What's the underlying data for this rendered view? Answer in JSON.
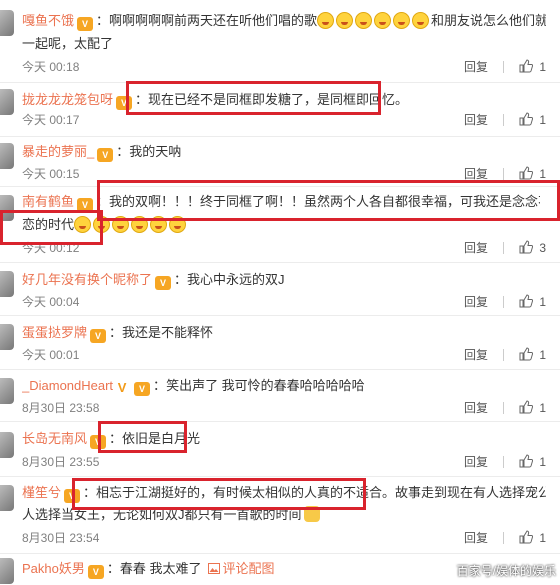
{
  "comments": [
    {
      "user": "嘎鱼不饿",
      "text": "啊啊啊啊啊前两天还在听他们唱的歌",
      "text_after": "和朋友说怎么他们就不在",
      "text_line2": "一起呢，太配了",
      "time": "今天 00:18",
      "reply": "回复",
      "likes": "1"
    },
    {
      "user": "拢龙龙龙笼包呀",
      "text": "现在已经不是同框即发糖了，是同框即回忆。",
      "time": "今天 00:17",
      "reply": "回复",
      "likes": "1"
    },
    {
      "user": "暴走的萝丽_",
      "text": "我的天呐",
      "time": "今天 00:15",
      "reply": "回复",
      "likes": "1"
    },
    {
      "user": "南有鹤鱼",
      "text": "我的双啊！！！终于同框了啊！！虽然两个人各自都很幸福，可我还是念念不忘双J",
      "text_line2": "恋的时代",
      "time": "今天 00:12",
      "reply": "回复",
      "likes": "3"
    },
    {
      "user": "好几年没有换个昵称了",
      "text": "我心中永远的双J",
      "time": "今天 00:04",
      "reply": "回复",
      "likes": "1"
    },
    {
      "user": "蛋蛋挞罗牌",
      "text": "我还是不能释怀",
      "time": "今天 00:01",
      "reply": "回复",
      "likes": "1"
    },
    {
      "user": "_DiamondHeart",
      "text": "笑出声了 我可怜的春春哈哈哈哈哈",
      "time": "8月30日 23:58",
      "reply": "回复",
      "likes": "1"
    },
    {
      "user": "长岛无南风",
      "text": "依旧是白月光",
      "time": "8月30日 23:55",
      "reply": "回复",
      "likes": "1"
    },
    {
      "user": "槿笙兮",
      "text": "相忘于江湖挺好的，有时候太相似的人真的不适合。故事走到现在有人选择宠公主有",
      "text_line2": "人选择当女王，无论如何双J都只有一首歌的时间",
      "time": "8月30日 23:54",
      "reply": "回复",
      "likes": "1"
    },
    {
      "user": "Pakho妖男",
      "text": "春春 我太难了",
      "image_link": "评论配图"
    }
  ],
  "colon": "：",
  "vip_label": "V",
  "watermark": "百家号/娱体的娱乐",
  "colors": {
    "username": "#eb7350",
    "highlight_box": "#d9232d",
    "meta": "#808080"
  },
  "icons": {
    "like": "thumbs-up-icon",
    "vip": "vip-badge-icon",
    "emoji": "crying-face-emoji-icon",
    "image": "image-icon"
  }
}
